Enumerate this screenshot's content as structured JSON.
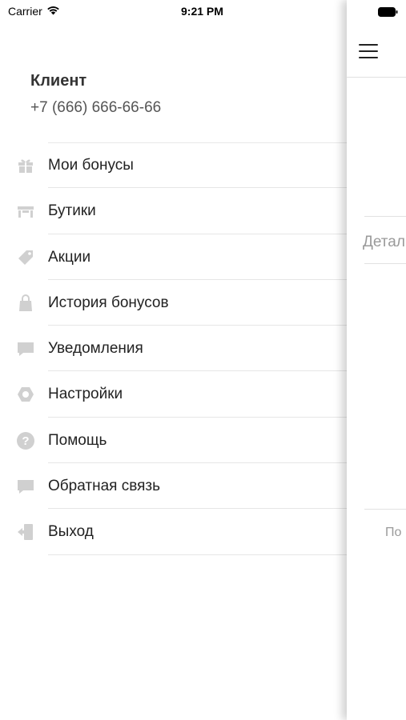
{
  "status_bar": {
    "carrier": "Carrier",
    "time": "9:21 PM"
  },
  "user": {
    "name": "Клиент",
    "phone": "+7 (666) 666-66-66"
  },
  "menu": {
    "items": [
      {
        "label": "Мои бонусы",
        "icon": "gift-icon"
      },
      {
        "label": "Бутики",
        "icon": "store-icon"
      },
      {
        "label": "Акции",
        "icon": "tag-icon"
      },
      {
        "label": "История бонусов",
        "icon": "shopping-bag-icon"
      },
      {
        "label": "Уведомления",
        "icon": "message-icon"
      },
      {
        "label": "Настройки",
        "icon": "gear-icon"
      },
      {
        "label": "Помощь",
        "icon": "help-icon"
      },
      {
        "label": "Обратная связь",
        "icon": "feedback-icon"
      },
      {
        "label": "Выход",
        "icon": "logout-icon"
      }
    ]
  },
  "main": {
    "peek_text_1": "Детал",
    "peek_text_2": "По"
  },
  "colors": {
    "icon_gray": "#d0d0d0",
    "text": "#222222",
    "divider": "#e6e6e6"
  }
}
